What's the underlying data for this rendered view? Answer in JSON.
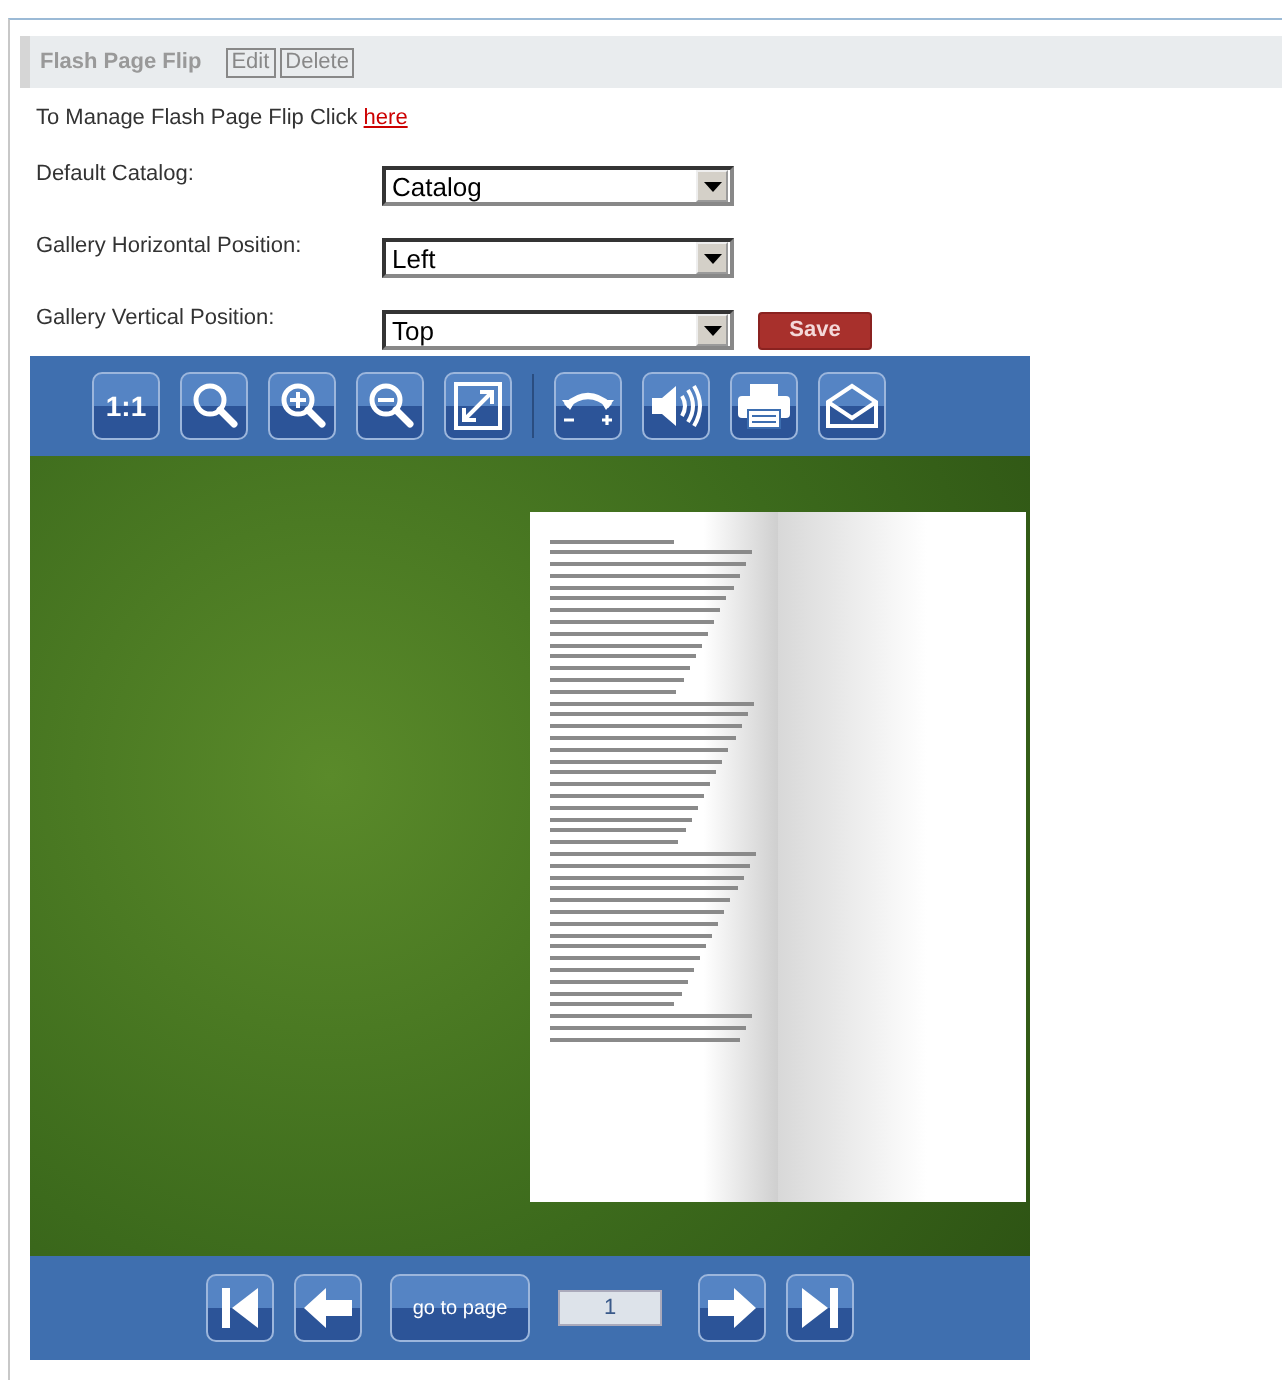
{
  "panel": {
    "title": "Flash Page Flip",
    "actions": [
      "Edit",
      "Delete"
    ]
  },
  "manage": {
    "text": "To Manage Flash Page Flip Click",
    "link": "here"
  },
  "settings": [
    {
      "label": "Default Catalog:",
      "value": "Catalog"
    },
    {
      "label": "Gallery Horizontal Position:",
      "value": "Left"
    },
    {
      "label": "Gallery Vertical Position:",
      "value": "Top"
    }
  ],
  "save_button": "Save",
  "viewer": {
    "toolbar": [
      {
        "kind": "actual-size",
        "text": "1:1"
      },
      {
        "kind": "search"
      },
      {
        "kind": "zoom-in"
      },
      {
        "kind": "zoom-out"
      },
      {
        "kind": "fullscreen"
      },
      {
        "kind": "separator"
      },
      {
        "kind": "flip"
      },
      {
        "kind": "sound"
      },
      {
        "kind": "print"
      },
      {
        "kind": "email"
      }
    ],
    "goto_label": "go to page",
    "page_number": "1"
  }
}
